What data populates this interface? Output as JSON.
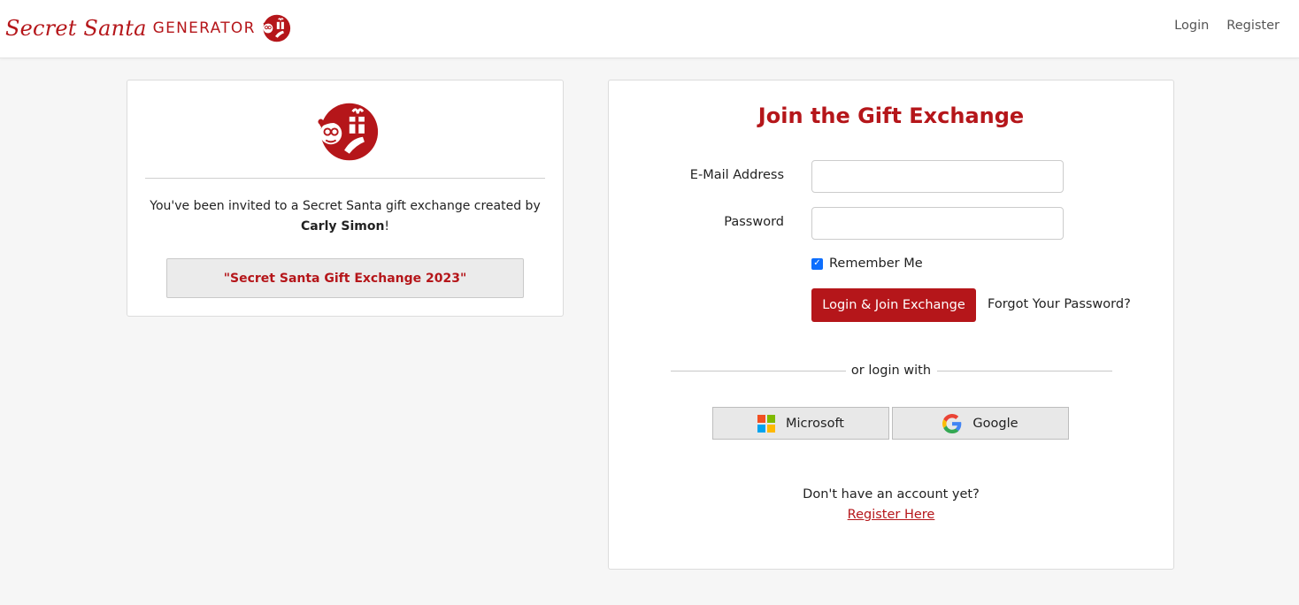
{
  "brand": {
    "script": "Secret Santa",
    "suffix": "GENERATOR",
    "logo_icon": "santa-gift-logo-icon",
    "accent_color": "#b5161a"
  },
  "nav": {
    "login": "Login",
    "register": "Register"
  },
  "invite": {
    "logo_icon": "santa-gift-logo-icon",
    "text_prefix": "You've been invited to a Secret Santa gift exchange created by",
    "creator": "Carly Simon",
    "text_suffix": "!",
    "exchange_name": "\"Secret Santa Gift Exchange 2023\""
  },
  "login_form": {
    "title": "Join the Gift Exchange",
    "email_label": "E-Mail Address",
    "email_value": "",
    "password_label": "Password",
    "password_value": "",
    "remember_label": "Remember Me",
    "remember_checked": true,
    "submit_label": "Login & Join Exchange",
    "forgot_label": "Forgot Your Password?",
    "divider_text": "or login with",
    "microsoft_label": "Microsoft",
    "microsoft_icon": "microsoft-icon",
    "google_label": "Google",
    "google_icon": "google-icon",
    "no_account_text": "Don't have an account yet?",
    "register_link": "Register Here"
  }
}
